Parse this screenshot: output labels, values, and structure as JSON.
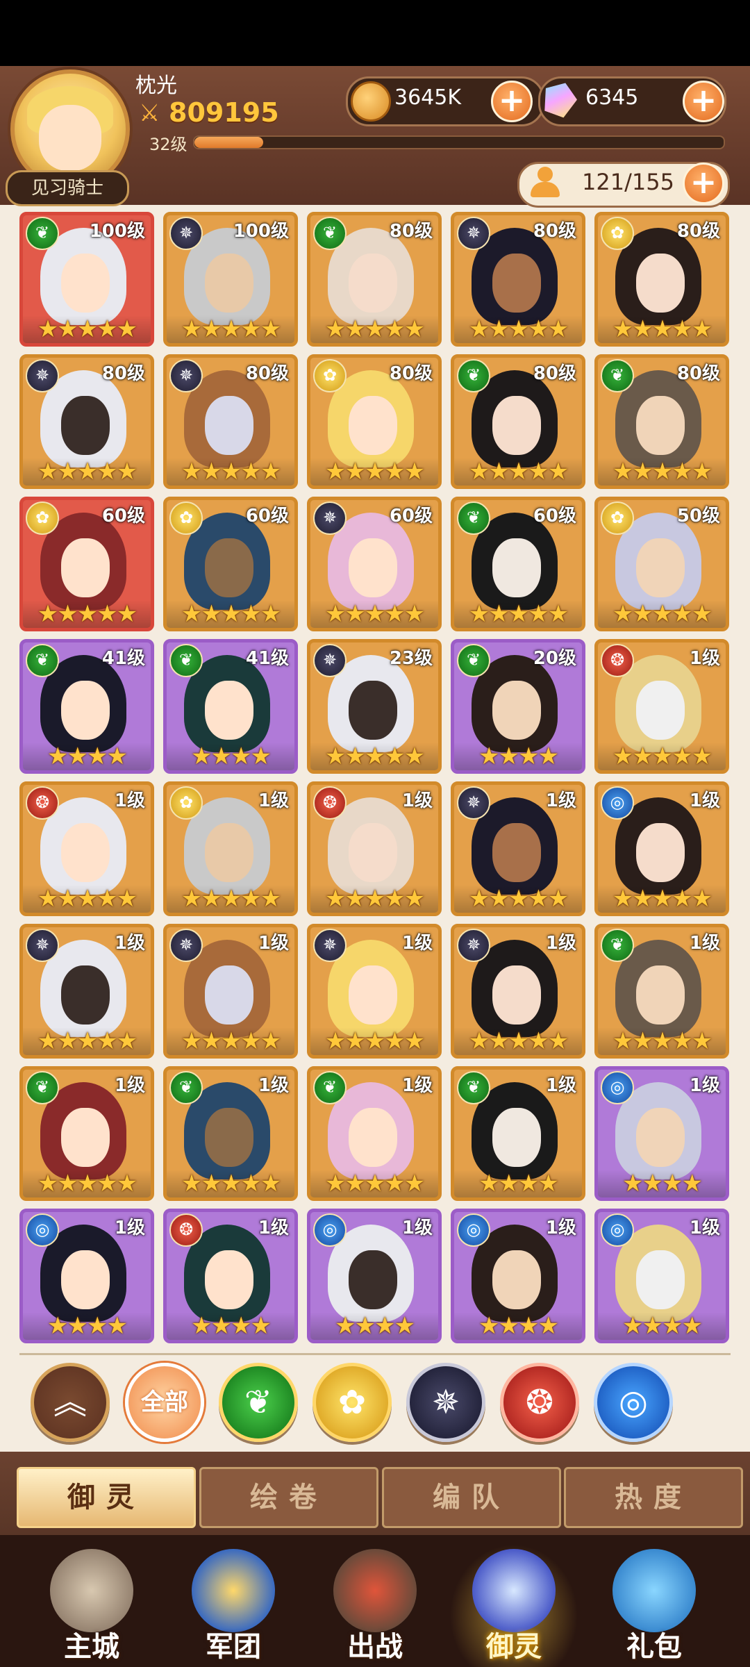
{
  "player": {
    "name": "枕光",
    "power": "809195",
    "level_label": "32级",
    "xp_progress": 0.13,
    "rank": "见习骑士"
  },
  "resources": {
    "coins": "3645K",
    "gems": "6345",
    "heroes": "121/155"
  },
  "heroes": [
    {
      "level": "100级",
      "faction": "nature",
      "border": "red",
      "stars": 5
    },
    {
      "level": "100级",
      "faction": "dark",
      "border": "orange",
      "stars": 5
    },
    {
      "level": "80级",
      "faction": "nature",
      "border": "orange",
      "stars": 5
    },
    {
      "level": "80级",
      "faction": "dark",
      "border": "orange",
      "stars": 5
    },
    {
      "level": "80级",
      "faction": "light",
      "border": "orange",
      "stars": 5
    },
    {
      "level": "80级",
      "faction": "dark",
      "border": "orange",
      "stars": 5
    },
    {
      "level": "80级",
      "faction": "dark",
      "border": "orange",
      "stars": 5
    },
    {
      "level": "80级",
      "faction": "light",
      "border": "orange",
      "stars": 5
    },
    {
      "level": "80级",
      "faction": "nature",
      "border": "orange",
      "stars": 5
    },
    {
      "level": "80级",
      "faction": "nature",
      "border": "orange",
      "stars": 5
    },
    {
      "level": "60级",
      "faction": "light",
      "border": "red",
      "stars": 5
    },
    {
      "level": "60级",
      "faction": "light",
      "border": "orange",
      "stars": 5
    },
    {
      "level": "60级",
      "faction": "dark",
      "border": "orange",
      "stars": 5
    },
    {
      "level": "60级",
      "faction": "nature",
      "border": "orange",
      "stars": 5
    },
    {
      "level": "50级",
      "faction": "light",
      "border": "orange",
      "stars": 5
    },
    {
      "level": "41级",
      "faction": "nature",
      "border": "purple",
      "stars": 4
    },
    {
      "level": "41级",
      "faction": "nature",
      "border": "purple",
      "stars": 4
    },
    {
      "level": "23级",
      "faction": "dark",
      "border": "orange",
      "stars": 5
    },
    {
      "level": "20级",
      "faction": "nature",
      "border": "purple",
      "stars": 4
    },
    {
      "level": "1级",
      "faction": "fire",
      "border": "orange",
      "stars": 5
    },
    {
      "level": "1级",
      "faction": "fire",
      "border": "orange",
      "stars": 5
    },
    {
      "level": "1级",
      "faction": "light",
      "border": "orange",
      "stars": 5
    },
    {
      "level": "1级",
      "faction": "fire",
      "border": "orange",
      "stars": 5
    },
    {
      "level": "1级",
      "faction": "dark",
      "border": "orange",
      "stars": 5
    },
    {
      "level": "1级",
      "faction": "water",
      "border": "orange",
      "stars": 5
    },
    {
      "level": "1级",
      "faction": "dark",
      "border": "orange",
      "stars": 5
    },
    {
      "level": "1级",
      "faction": "dark",
      "border": "orange",
      "stars": 5
    },
    {
      "level": "1级",
      "faction": "dark",
      "border": "orange",
      "stars": 5
    },
    {
      "level": "1级",
      "faction": "dark",
      "border": "orange",
      "stars": 5
    },
    {
      "level": "1级",
      "faction": "nature",
      "border": "orange",
      "stars": 5
    },
    {
      "level": "1级",
      "faction": "nature",
      "border": "orange",
      "stars": 5
    },
    {
      "level": "1级",
      "faction": "nature",
      "border": "orange",
      "stars": 5
    },
    {
      "level": "1级",
      "faction": "nature",
      "border": "orange",
      "stars": 5
    },
    {
      "level": "1级",
      "faction": "nature",
      "border": "orange",
      "stars": 4
    },
    {
      "level": "1级",
      "faction": "water",
      "border": "purple",
      "stars": 4
    },
    {
      "level": "1级",
      "faction": "water",
      "border": "purple",
      "stars": 4
    },
    {
      "level": "1级",
      "faction": "fire",
      "border": "purple",
      "stars": 4
    },
    {
      "level": "1级",
      "faction": "water",
      "border": "purple",
      "stars": 4
    },
    {
      "level": "1级",
      "faction": "water",
      "border": "purple",
      "stars": 4
    },
    {
      "level": "1级",
      "faction": "water",
      "border": "purple",
      "stars": 4
    }
  ],
  "filters": {
    "all_label": "全部",
    "items": [
      "collapse",
      "all",
      "nature",
      "light",
      "dark",
      "fire",
      "water"
    ],
    "active": "all"
  },
  "subtabs": [
    {
      "label": "御灵",
      "active": true
    },
    {
      "label": "绘卷",
      "active": false
    },
    {
      "label": "编队",
      "active": false
    },
    {
      "label": "热度",
      "active": false
    }
  ],
  "nav": [
    {
      "label": "主城",
      "active": false
    },
    {
      "label": "军团",
      "active": false
    },
    {
      "label": "出战",
      "active": false
    },
    {
      "label": "御灵",
      "active": true
    },
    {
      "label": "礼包",
      "active": false
    }
  ],
  "colors": {
    "accent_orange": "#e07a2b",
    "star_gold": "#ffc83a",
    "frame_brown": "#6b4230"
  }
}
